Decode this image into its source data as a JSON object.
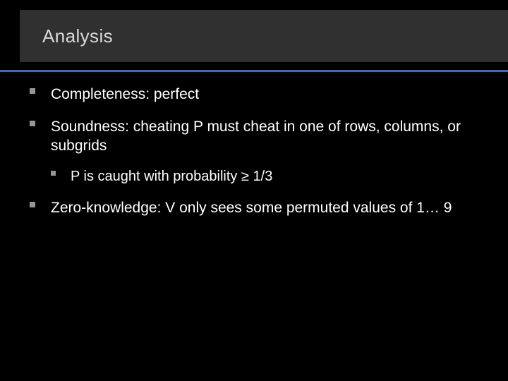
{
  "title": "Analysis",
  "bullets": [
    {
      "text": "Completeness: perfect",
      "children": []
    },
    {
      "text": "Soundness: cheating P must cheat in one of rows, columns, or subgrids",
      "children": [
        {
          "text": "P is caught with probability ≥ 1/3"
        }
      ]
    },
    {
      "text": "Zero-knowledge: V only sees some permuted values of 1… 9",
      "children": []
    }
  ]
}
